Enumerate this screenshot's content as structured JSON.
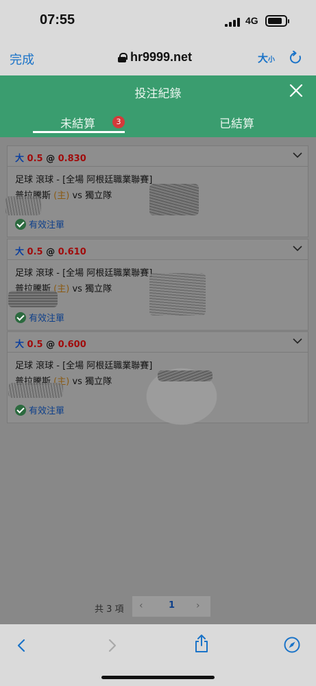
{
  "status_bar": {
    "time": "07:55",
    "network": "4G"
  },
  "browser": {
    "done_label": "完成",
    "url": "hr9999.net",
    "text_size_label": "大",
    "text_size_small": "小"
  },
  "modal": {
    "title": "投注紀錄",
    "tabs": [
      {
        "label": "未結算",
        "badge": "3"
      },
      {
        "label": "已結算"
      }
    ]
  },
  "bets": [
    {
      "side": "大",
      "handicap": "0.5",
      "at": "@",
      "odds": "0.830",
      "league": "足球 滾球 - [全場 阿根廷職業聯賽]",
      "home_team": "普拉騰斯",
      "home_tag": "(主)",
      "vs": "vs",
      "away_team": "獨立隊",
      "status": "有效注單"
    },
    {
      "side": "大",
      "handicap": "0.5",
      "at": "@",
      "odds": "0.610",
      "league": "足球 滾球 - [全場 阿根廷職業聯賽]",
      "home_team": "普拉騰斯",
      "home_tag": "(主)",
      "vs": "vs",
      "away_team": "獨立隊",
      "status": "有效注單"
    },
    {
      "side": "大",
      "handicap": "0.5",
      "at": "@",
      "odds": "0.600",
      "league": "足球 滾球 - [全場 阿根廷職業聯賽]",
      "home_team": "普拉騰斯",
      "home_tag": "(主)",
      "vs": "vs",
      "away_team": "獨立隊",
      "status": "有效注單"
    }
  ],
  "pagination": {
    "total": "共 3 項",
    "prev": "‹",
    "current": "1",
    "next": "›"
  },
  "colors": {
    "header_green": "#3a9d6f",
    "badge_red": "#d43a3a",
    "link_blue": "#1a73c8",
    "odds_red": "#a00c0c"
  }
}
